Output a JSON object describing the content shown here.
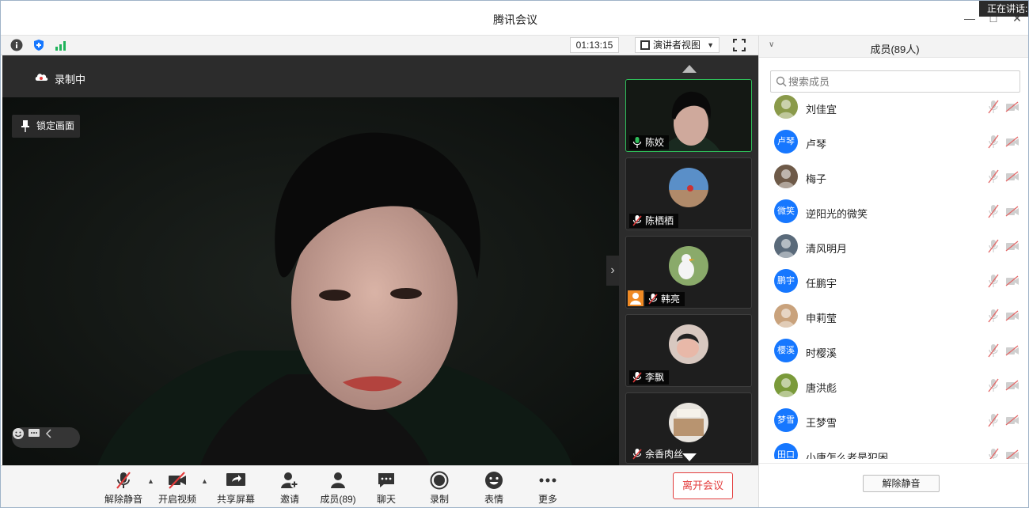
{
  "window": {
    "title": "腾讯会议",
    "speaking_label": "正在讲话:",
    "colors": {
      "accent": "#1677ff",
      "leave_red": "#e33c3c",
      "active_green": "#2fbf5a"
    }
  },
  "toolbar": {
    "icons": [
      "info-icon",
      "shield-icon",
      "signal-icon"
    ],
    "timer": "01:13:15",
    "view_mode": "演讲者视图"
  },
  "main_video": {
    "recording_label": "录制中",
    "lock_label": "锁定画面"
  },
  "thumbnails": [
    {
      "name": "陈姣",
      "mic": "on",
      "active": true
    },
    {
      "name": "陈栖栖",
      "mic": "muted",
      "active": false
    },
    {
      "name": "韩亮",
      "mic": "muted",
      "active": false,
      "host": true
    },
    {
      "name": "李飘",
      "mic": "muted",
      "active": false
    },
    {
      "name": "余香肉丝",
      "mic": "muted",
      "active": false
    }
  ],
  "controls": {
    "unmute": "解除静音",
    "start_video": "开启视频",
    "share_screen": "共享屏幕",
    "invite": "邀请",
    "members": "成员(89)",
    "chat": "聊天",
    "record": "录制",
    "emoji": "表情",
    "more": "更多",
    "leave": "离开会议"
  },
  "panel": {
    "title": "成员(89人)",
    "search_placeholder": "搜索成员",
    "members": [
      {
        "name": "刘佳宜",
        "avatar_text": "",
        "avatar_type": "photo",
        "color": "#8a9a4a"
      },
      {
        "name": "卢琴",
        "avatar_text": "卢琴",
        "avatar_type": "text",
        "color": "#1677ff"
      },
      {
        "name": "梅子",
        "avatar_text": "",
        "avatar_type": "photo",
        "color": "#6e5a48"
      },
      {
        "name": "逆阳光的微笑",
        "avatar_text": "微笑",
        "avatar_type": "text",
        "color": "#1677ff"
      },
      {
        "name": "清风明月",
        "avatar_text": "",
        "avatar_type": "photo",
        "color": "#5a6a7a"
      },
      {
        "name": "任鹏宇",
        "avatar_text": "鹏宇",
        "avatar_type": "text",
        "color": "#1677ff"
      },
      {
        "name": "申莉莹",
        "avatar_text": "",
        "avatar_type": "photo",
        "color": "#c9a27c"
      },
      {
        "name": "时樱溪",
        "avatar_text": "樱溪",
        "avatar_type": "text",
        "color": "#1677ff"
      },
      {
        "name": "唐洪彪",
        "avatar_text": "",
        "avatar_type": "photo",
        "color": "#7a9a3a"
      },
      {
        "name": "王梦雪",
        "avatar_text": "梦雪",
        "avatar_type": "text",
        "color": "#1677ff"
      },
      {
        "name": "小唐怎么老是犯困",
        "avatar_text": "田口",
        "avatar_type": "text",
        "color": "#1677ff"
      }
    ],
    "unmute_all": "解除静音"
  }
}
